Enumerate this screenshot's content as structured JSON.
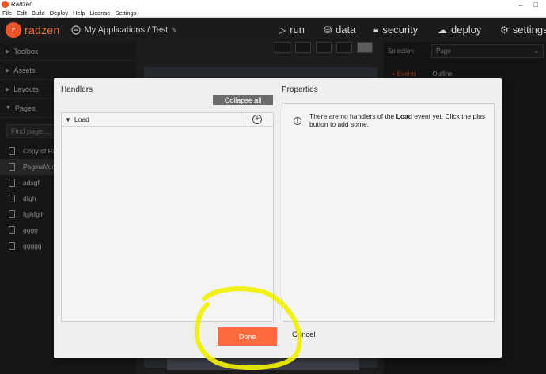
{
  "window": {
    "title": "Radzen"
  },
  "menu": [
    "File",
    "Edit",
    "Build",
    "Deploy",
    "Help",
    "License",
    "Settings"
  ],
  "topbar": {
    "logo_text": "radzen",
    "project_path": "My Applications / Test",
    "nav": [
      {
        "icon": "play-icon",
        "label": "run"
      },
      {
        "icon": "data-icon",
        "label": "data"
      },
      {
        "icon": "lock-icon",
        "label": "security"
      },
      {
        "icon": "cloud-upload-icon",
        "label": "deploy"
      },
      {
        "icon": "gear-icon",
        "label": "settings"
      }
    ]
  },
  "sidebar": {
    "sections": [
      "Toolbox",
      "Assets",
      "Layouts",
      "Pages"
    ],
    "search_placeholder": "Find page ...",
    "pages": [
      "Copy of Pa",
      "PaginaVuo",
      "adsgf",
      "dfgh",
      "fgjhfgjh",
      "gggg",
      "ggggg"
    ],
    "selected_page_index": 1
  },
  "right_panel": {
    "selection_label": "Selection",
    "selection_value": "Page",
    "tabs": [
      "Events",
      "Outline"
    ]
  },
  "modal": {
    "handlers_title": "Handlers",
    "properties_title": "Properties",
    "collapse_all": "Collapse all",
    "event_name": "Load",
    "info_msg_pre": "There are no handlers of the ",
    "info_msg_event": "Load",
    "info_msg_post": " event yet. Click the plus button to add some.",
    "done_label": "Done",
    "cancel_label": "Cancel"
  },
  "colors": {
    "accent": "#ff6b3d",
    "highlight": "#f0f000",
    "dark_bg": "#1b1b1b"
  }
}
